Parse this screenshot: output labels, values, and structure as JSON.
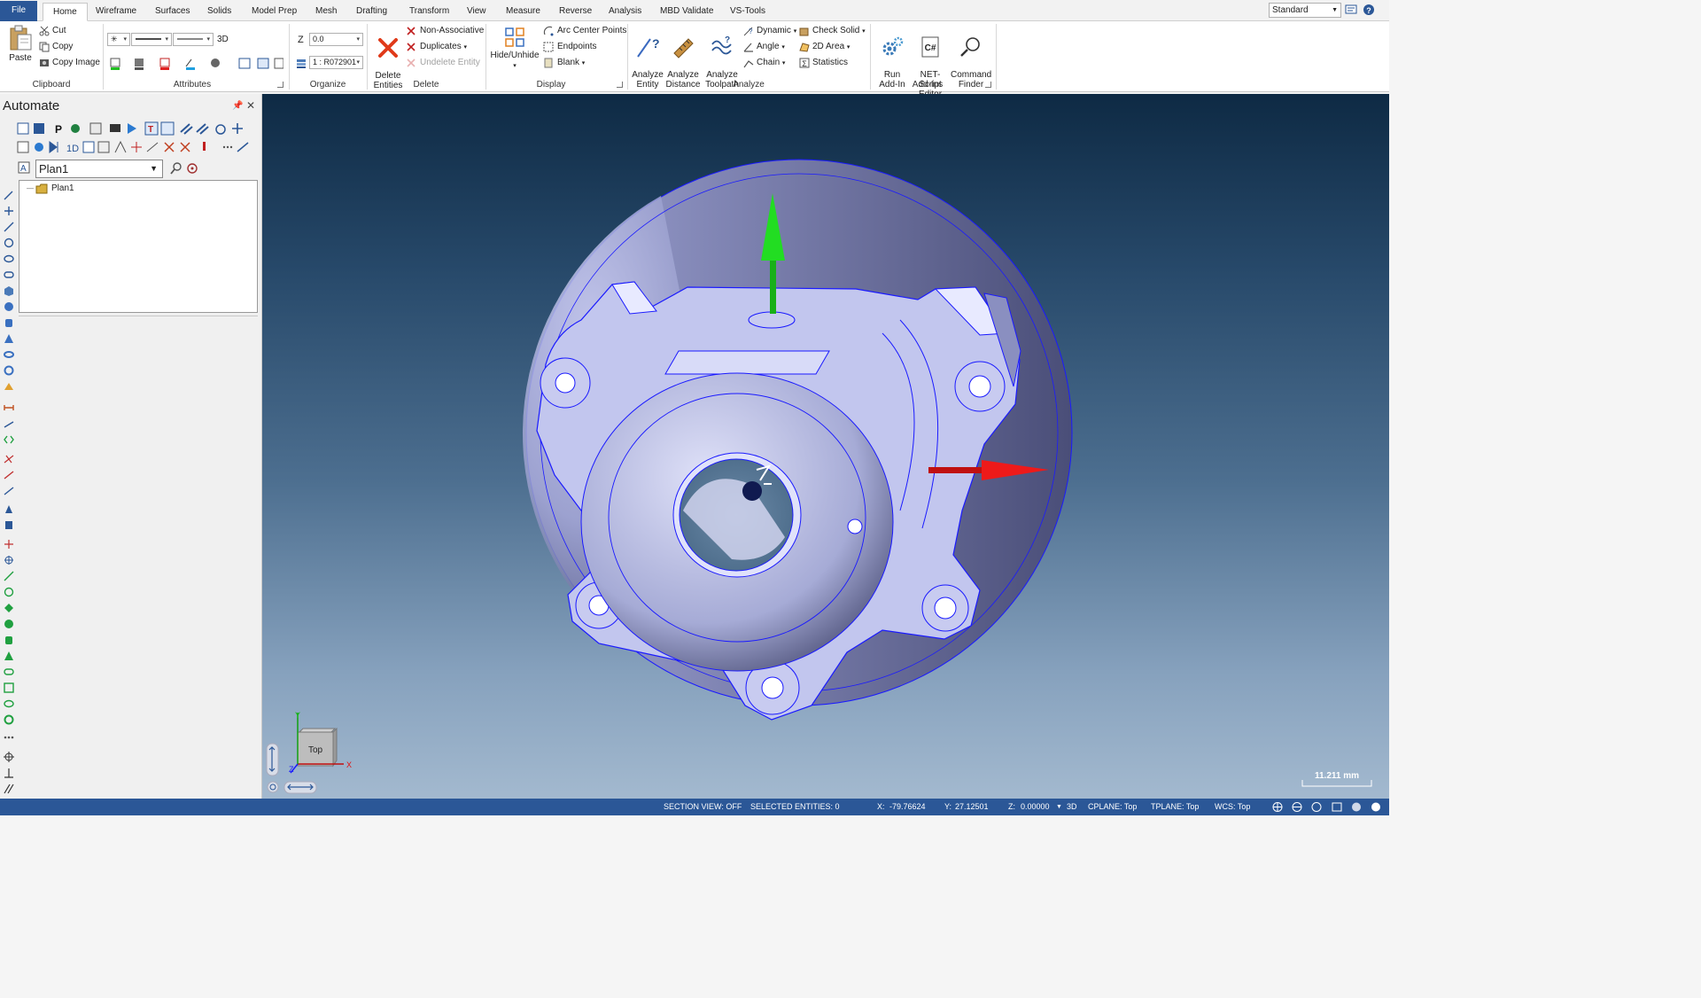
{
  "tabs": {
    "file": "File",
    "items": [
      "Home",
      "Wireframe",
      "Surfaces",
      "Solids",
      "Model Prep",
      "Mesh",
      "Drafting",
      "Transform",
      "View",
      "Measure",
      "Reverse",
      "Analysis",
      "MBD Validate",
      "VS-Tools"
    ],
    "active": "Home"
  },
  "style_select": {
    "value": "Standard"
  },
  "clipboard": {
    "paste": "Paste",
    "cut": "Cut",
    "copy": "Copy",
    "copy_image": "Copy Image",
    "label": "Clipboard"
  },
  "attributes": {
    "mode_3d": "3D",
    "label": "Attributes"
  },
  "organize": {
    "z_label": "Z",
    "z_value": "0.0",
    "level_value": "1 : R072901",
    "label": "Organize"
  },
  "delete": {
    "delete_entities": "Delete\nEntities",
    "non_associative": "Non-Associative",
    "duplicates": "Duplicates",
    "undelete": "Undelete Entity",
    "label": "Delete"
  },
  "display": {
    "hide_unhide": "Hide/Unhide",
    "arc_center": "Arc Center Points",
    "endpoints": "Endpoints",
    "blank": "Blank",
    "label": "Display"
  },
  "analyze": {
    "analyze_entity": "Analyze\nEntity",
    "analyze_distance": "Analyze\nDistance",
    "analyze_toolpath": "Analyze\nToolpath",
    "dynamic": "Dynamic",
    "angle": "Angle",
    "chain": "Chain",
    "check_solid": "Check Solid",
    "area_2d": "2D Area",
    "statistics": "Statistics",
    "label": "Analyze"
  },
  "addins": {
    "run_addin": "Run\nAdd-In",
    "net_script": "NET-Script\nEditor",
    "command_finder": "Command\nFinder",
    "label": "Add-Ins"
  },
  "panel": {
    "title": "Automate",
    "plan_value": "Plan1",
    "tree_item": "Plan1"
  },
  "viewport": {
    "view_cube_label": "Top",
    "axis_x": "X",
    "axis_y": "Y",
    "axis_z": "Z",
    "scale": "11.211 mm"
  },
  "status": {
    "section_view": "SECTION VIEW: OFF",
    "selected": "SELECTED ENTITIES: 0",
    "x_label": "X:",
    "x_value": "-79.76624",
    "y_label": "Y:",
    "y_value": "27.12501",
    "z_label": "Z:",
    "z_value": "0.00000",
    "mode": "3D",
    "cplane": "CPLANE: Top",
    "tplane": "TPLANE: Top",
    "wcs": "WCS: Top"
  },
  "colors": {
    "accent": "#2b5797",
    "model_edge": "#1a1aff",
    "model_face": "#b8bce8",
    "x_axis": "#e01010",
    "y_axis": "#10c010"
  },
  "icons": [
    "paste-icon",
    "cut-icon",
    "copy-icon",
    "delete-x-icon",
    "analyze-icon",
    "gear-icon",
    "csharp-icon",
    "binoculars-icon"
  ]
}
